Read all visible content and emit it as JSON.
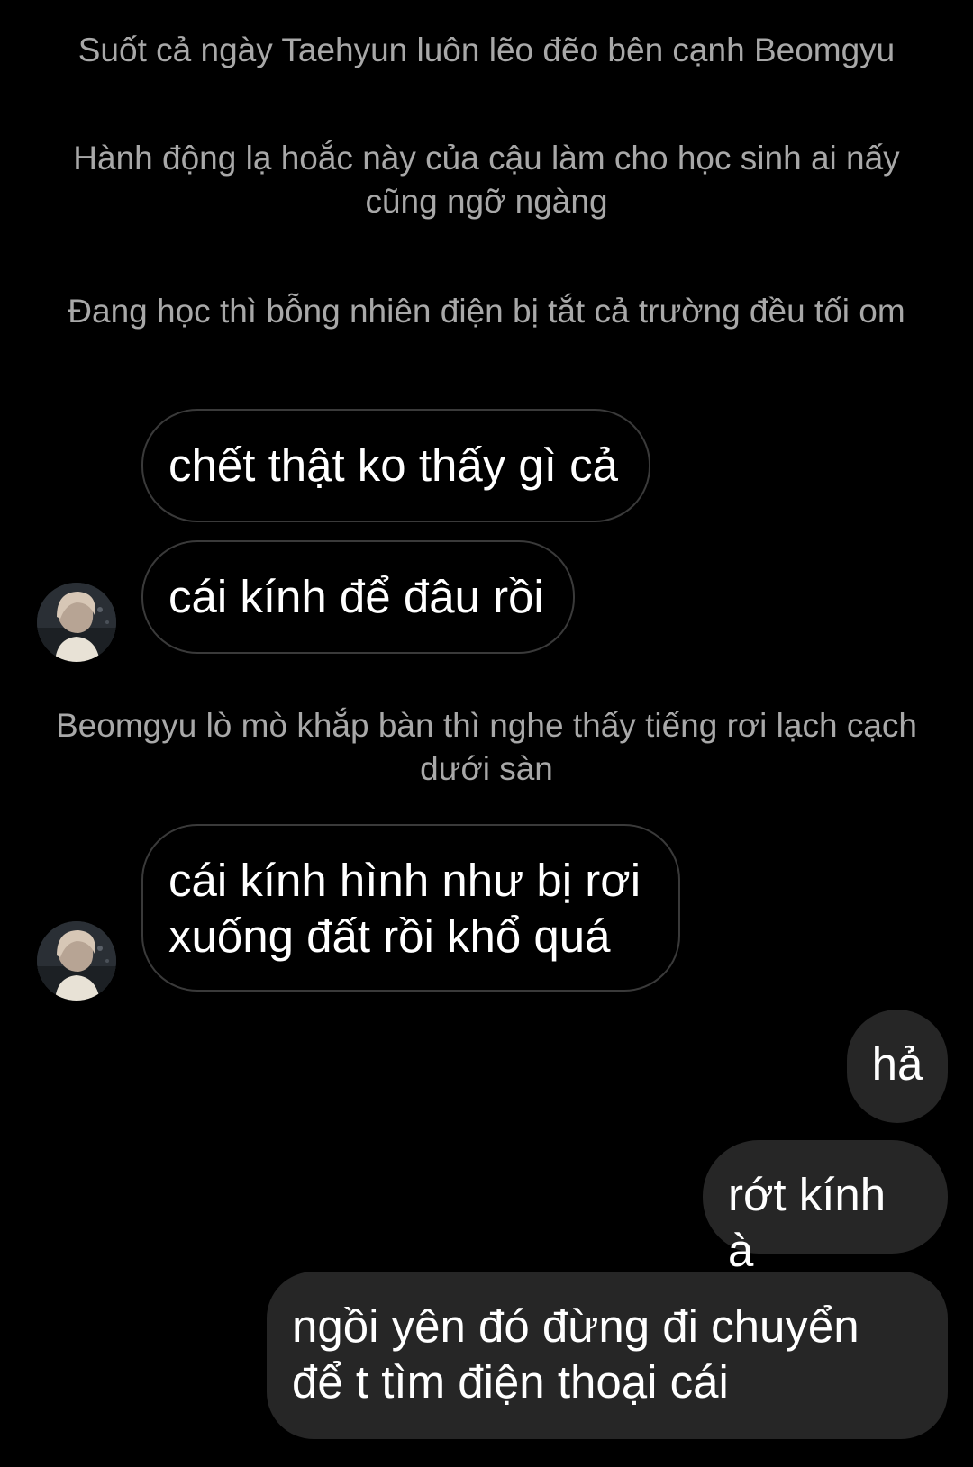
{
  "narration": [
    "Suốt cả ngày Taehyun luôn lẽo đẽo bên cạnh Beomgyu",
    "Hành động lạ hoắc này của cậu làm cho học sinh ai nấy cũng ngỡ ngàng",
    "Đang học thì bỗng nhiên điện bị tắt cả trường đều tối om",
    "Beomgyu lò mò khắp bàn thì nghe thấy tiếng rơi lạch cạch dưới sàn"
  ],
  "incoming": [
    "chết thật ko thấy gì cả",
    "cái kính để đâu rồi",
    "cái kính hình như bị rơi xuống đất rồi khổ quá"
  ],
  "outgoing": [
    "hả",
    "rớt kính à",
    "ngồi yên đó đừng đi chuyển để t tìm điện thoại cái"
  ],
  "colors": {
    "background": "#000000",
    "narration_text": "#a8a8a8",
    "incoming_border": "#3a3a3a",
    "outgoing_bubble": "#262626",
    "message_text": "#ffffff"
  },
  "icons": {
    "avatar": "profile-photo-avatar"
  }
}
